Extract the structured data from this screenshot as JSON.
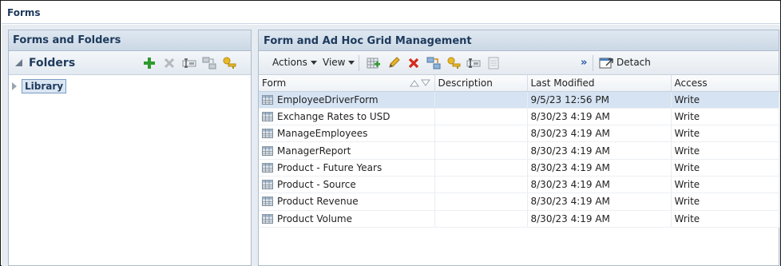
{
  "page": {
    "title": "Forms"
  },
  "left_panel": {
    "title": "Forms and Folders",
    "folders_label": "Folders",
    "tree": {
      "root": "Library"
    }
  },
  "right_panel": {
    "title": "Form and Ad Hoc Grid Management",
    "toolbar": {
      "actions": "Actions",
      "view": "View",
      "more": "»",
      "detach": "Detach"
    },
    "columns": {
      "form": "Form",
      "description": "Description",
      "last_modified": "Last Modified",
      "access": "Access"
    },
    "rows": [
      {
        "form": "EmployeeDriverForm",
        "description": "",
        "last_modified": "9/5/23 12:56 PM",
        "access": "Write"
      },
      {
        "form": "Exchange Rates to USD",
        "description": "",
        "last_modified": "8/30/23 4:19 AM",
        "access": "Write"
      },
      {
        "form": "ManageEmployees",
        "description": "",
        "last_modified": "8/30/23 4:19 AM",
        "access": "Write"
      },
      {
        "form": "ManagerReport",
        "description": "",
        "last_modified": "8/30/23 4:19 AM",
        "access": "Write"
      },
      {
        "form": "Product - Future Years",
        "description": "",
        "last_modified": "8/30/23 4:19 AM",
        "access": "Write"
      },
      {
        "form": "Product - Source",
        "description": "",
        "last_modified": "8/30/23 4:19 AM",
        "access": "Write"
      },
      {
        "form": "Product Revenue",
        "description": "",
        "last_modified": "8/30/23 4:19 AM",
        "access": "Write"
      },
      {
        "form": "Product Volume",
        "description": "",
        "last_modified": "8/30/23 4:19 AM",
        "access": "Write"
      }
    ],
    "selected_row": 0
  },
  "colors": {
    "header_text": "#1e3a5c",
    "selected_row": "#d5e3f3",
    "accent_link": "#2a58a8"
  }
}
